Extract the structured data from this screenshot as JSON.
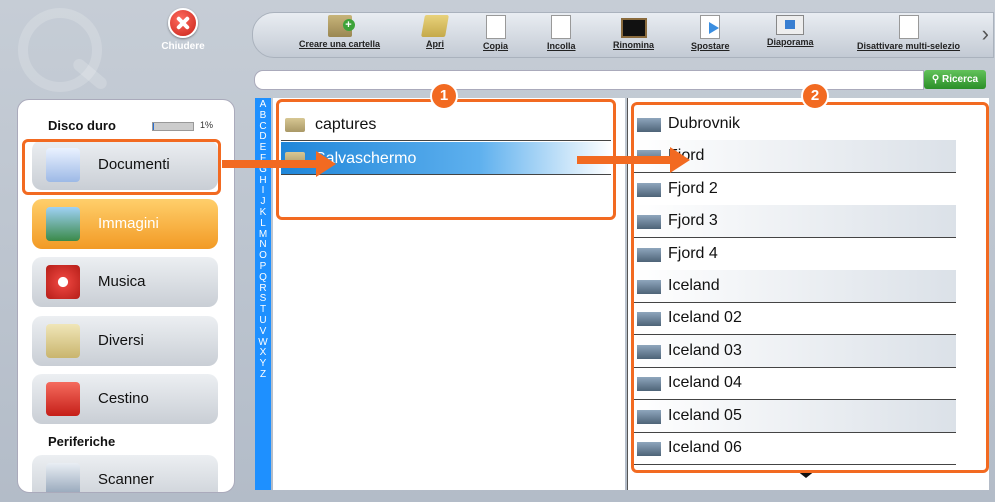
{
  "close": {
    "label": "Chiudere"
  },
  "toolbar": {
    "items": [
      {
        "label": "Creare una cartella",
        "icon": "new-folder-icon"
      },
      {
        "label": "Apri",
        "icon": "open-folder-icon"
      },
      {
        "label": "Copia",
        "icon": "copy-icon"
      },
      {
        "label": "Incolla",
        "icon": "paste-icon"
      },
      {
        "label": "Rinomina",
        "icon": "rename-icon"
      },
      {
        "label": "Spostare",
        "icon": "move-icon"
      },
      {
        "label": "Diaporama",
        "icon": "slideshow-icon"
      },
      {
        "label": "Disattivare multi-selezio",
        "icon": "multiselect-icon"
      }
    ]
  },
  "search": {
    "value": "",
    "button_label": "Ricerca"
  },
  "sidebar": {
    "disk_title": "Disco duro",
    "disk_usage": "1%",
    "disk_usage_fraction": 0.01,
    "items": [
      {
        "label": "Documenti"
      },
      {
        "label": "Immagini"
      },
      {
        "label": "Musica"
      },
      {
        "label": "Diversi"
      },
      {
        "label": "Cestino"
      }
    ],
    "devices_title": "Periferiche",
    "device_item": "Scanner"
  },
  "letters": [
    "A",
    "B",
    "C",
    "D",
    "E",
    "F",
    "G",
    "H",
    "I",
    "J",
    "K",
    "L",
    "M",
    "N",
    "O",
    "P",
    "Q",
    "R",
    "S",
    "T",
    "U",
    "V",
    "W",
    "X",
    "Y",
    "Z"
  ],
  "folders": [
    "captures",
    "Salvaschermo"
  ],
  "files": [
    "Dubrovnik",
    "Fjord",
    "Fjord 2",
    "Fjord 3",
    "Fjord 4",
    "Iceland",
    "Iceland 02",
    "Iceland 03",
    "Iceland 04",
    "Iceland 05",
    "Iceland 06"
  ],
  "annotations": {
    "badge1": "1",
    "badge2": "2"
  },
  "colors": {
    "accent": "#f26a21",
    "selection": "#1f86d9",
    "active_category": "#f29a25"
  }
}
